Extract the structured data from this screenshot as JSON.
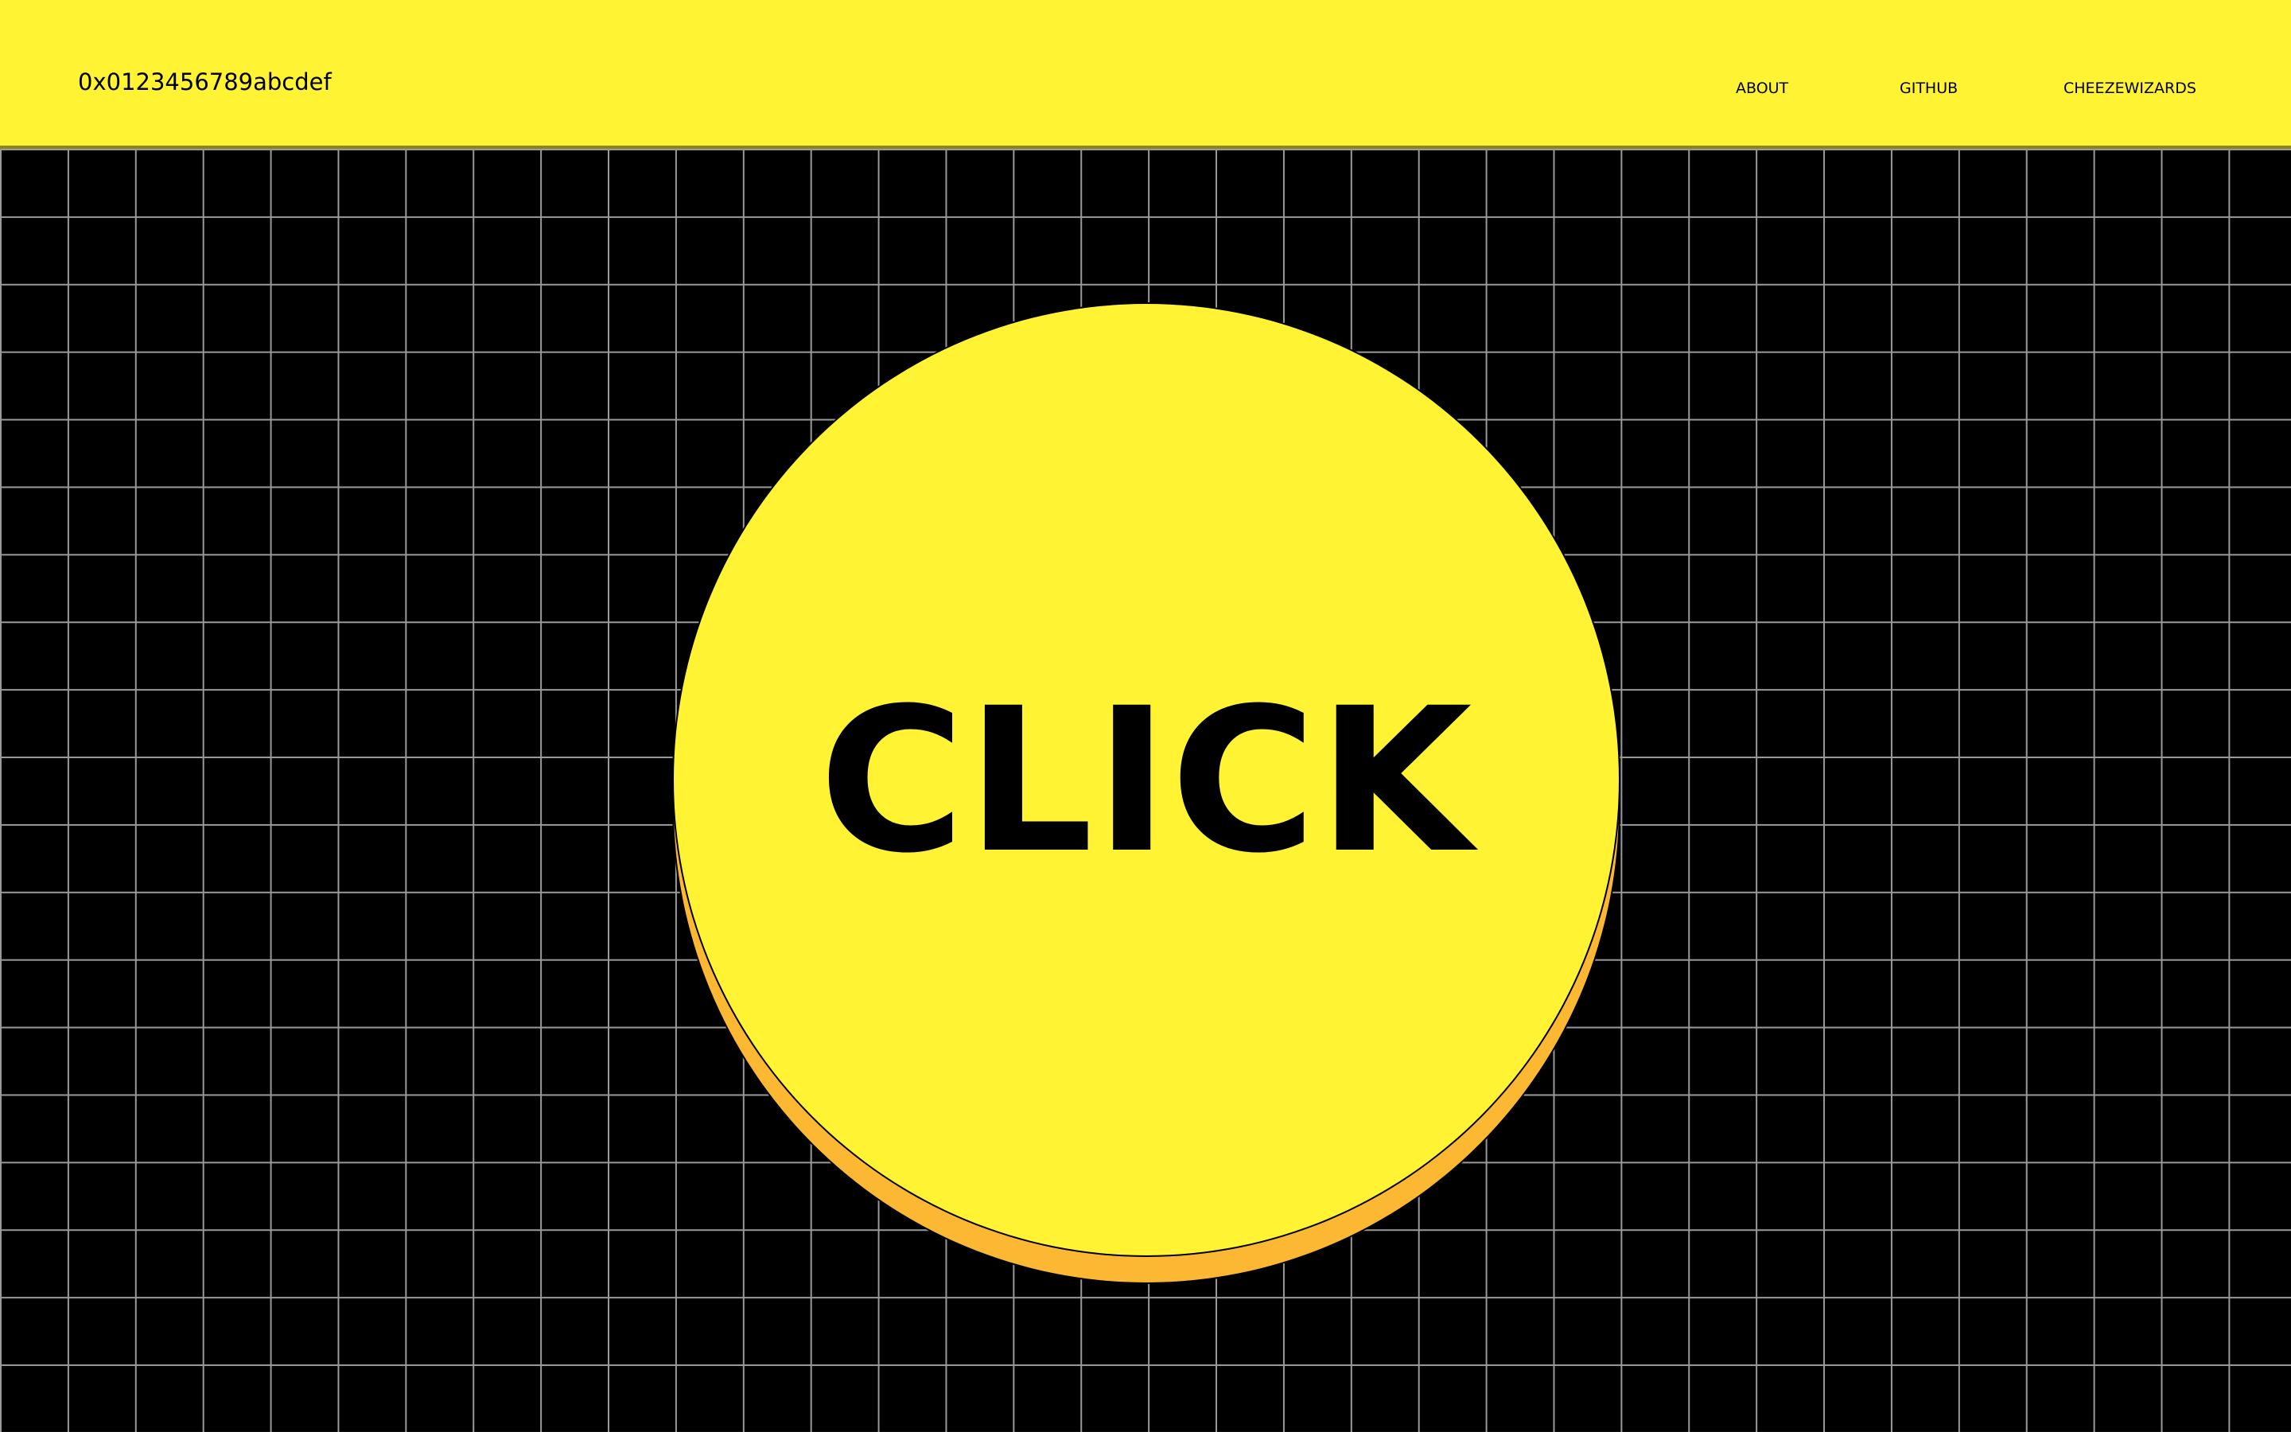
{
  "header": {
    "wallet_address": "0x0123456789abcdef",
    "nav": {
      "about": "ABOUT",
      "github": "GITHUB",
      "cheezewizards": "CHEEZEWIZARDS"
    }
  },
  "main": {
    "button_label": "CLICK"
  },
  "colors": {
    "brand_yellow": "#fff334",
    "button_shadow": "#fcb833",
    "background": "#000000",
    "grid_line": "#9a9a9a"
  }
}
